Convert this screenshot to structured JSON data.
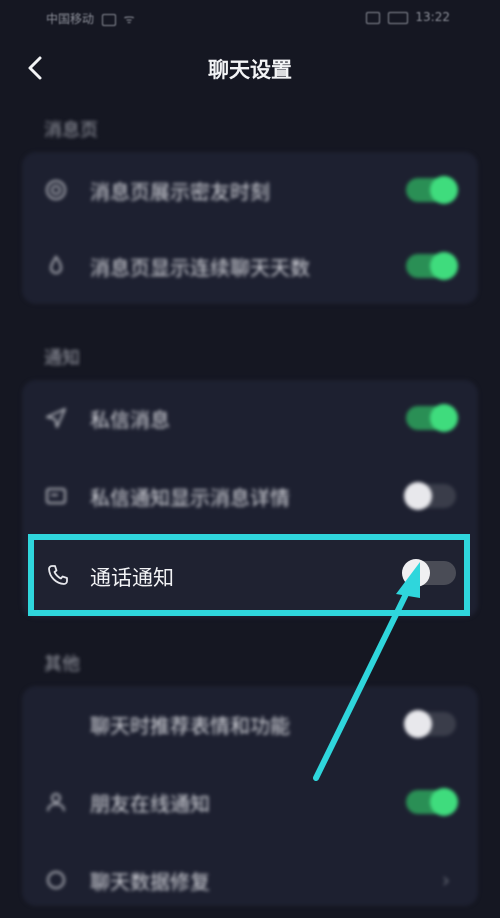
{
  "status_bar": {
    "carrier": "中国移动",
    "time": "13:22"
  },
  "header": {
    "title": "聊天设置"
  },
  "sections": {
    "messages": {
      "label": "消息页",
      "items": [
        {
          "label": "消息页展示密友时刻",
          "toggle": "on"
        },
        {
          "label": "消息页显示连续聊天天数",
          "toggle": "on"
        }
      ]
    },
    "notify": {
      "label": "通知",
      "items": [
        {
          "label": "私信消息",
          "toggle": "on"
        },
        {
          "label": "私信通知显示消息详情",
          "toggle": "off"
        },
        {
          "label": "通话通知",
          "toggle": "off"
        }
      ]
    },
    "other": {
      "label": "其他",
      "items": [
        {
          "label": "聊天时推荐表情和功能",
          "toggle": "off"
        },
        {
          "label": "朋友在线通知",
          "toggle": "on"
        },
        {
          "label": "聊天数据修复",
          "toggle": "none"
        }
      ]
    }
  },
  "colors": {
    "accent_green": "#3fdc7d",
    "highlight_cyan": "#2fd6dc",
    "background": "#151722"
  }
}
